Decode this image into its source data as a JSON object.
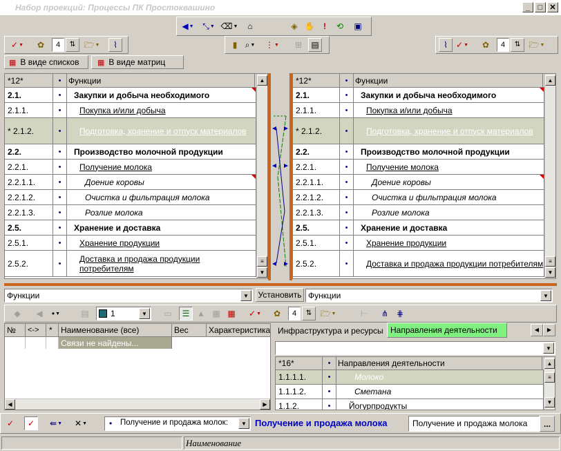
{
  "window": {
    "title": "Набор проекций: Процессы ПК Простоквашино",
    "min": "_",
    "max": "□",
    "close": "✕"
  },
  "toolbar_left": {
    "counter": "4"
  },
  "toolbar_right": {
    "counter": "4"
  },
  "view_tabs": {
    "list": "В виде списков",
    "matrix": "В виде матриц"
  },
  "left_table": {
    "header": {
      "col1": "*12*",
      "col2": "•",
      "col3": "Функции"
    },
    "rows": [
      {
        "num": "2.1.",
        "dot": "•",
        "name": "Закупки и добыча необходимого"
      },
      {
        "num": "2.1.1.",
        "dot": "•",
        "name": "Покупка и/или добыча"
      },
      {
        "num": "* 2.1.2.",
        "dot": "•",
        "name": "Подготовка, хранение и отпуск материалов"
      },
      {
        "num": "2.2.",
        "dot": "•",
        "name": "Производство молочной продукции"
      },
      {
        "num": "2.2.1.",
        "dot": "•",
        "name": "Получение молока"
      },
      {
        "num": "2.2.1.1.",
        "dot": "•",
        "name": "Доение коровы"
      },
      {
        "num": "2.2.1.2.",
        "dot": "•",
        "name": "Очистка и фильтрация молока"
      },
      {
        "num": "2.2.1.3.",
        "dot": "•",
        "name": "Розлие молока"
      },
      {
        "num": "2.5.",
        "dot": "•",
        "name": "Хранение и доставка"
      },
      {
        "num": "2.5.1.",
        "dot": "•",
        "name": "Хранение продукции"
      },
      {
        "num": "2.5.2.",
        "dot": "•",
        "name": "Доставка и продажа продукции потребителям"
      }
    ]
  },
  "right_table": {
    "header": {
      "col1": "*12*",
      "col2": "•",
      "col3": "Функции"
    },
    "rows": [
      {
        "num": "2.1.",
        "dot": "•",
        "name": "Закупки и добыча необходимого"
      },
      {
        "num": "2.1.1.",
        "dot": "•",
        "name": "Покупка и/или добыча"
      },
      {
        "num": "* 2.1.2.",
        "dot": "•",
        "name": "Подготовка, хранение и отпуск материалов"
      },
      {
        "num": "2.2.",
        "dot": "•",
        "name": "Производство молочной продукции"
      },
      {
        "num": "2.2.1.",
        "dot": "•",
        "name": "Получение молока"
      },
      {
        "num": "2.2.1.1.",
        "dot": "•",
        "name": "Доение коровы"
      },
      {
        "num": "2.2.1.2.",
        "dot": "•",
        "name": "Очистка и фильтрация молока"
      },
      {
        "num": "2.2.1.3.",
        "dot": "•",
        "name": "Розлие молока"
      },
      {
        "num": "2.5.",
        "dot": "•",
        "name": "Хранение и доставка"
      },
      {
        "num": "2.5.1.",
        "dot": "•",
        "name": "Хранение продукции"
      },
      {
        "num": "2.5.2.",
        "dot": "•",
        "name": "Доставка и продажа продукции потребителям"
      }
    ]
  },
  "filter": {
    "left_value": "Функции",
    "apply_button": "Установить",
    "right_value": "Функции"
  },
  "lower_toolbar": {
    "dot_value": "•",
    "level_value": "1",
    "counter": "4"
  },
  "links_table": {
    "headers": {
      "num": "№",
      "dir": "<->",
      "star": "*",
      "name": "Наименование (все)",
      "weight": "Вес",
      "char": "Характеристика"
    },
    "empty_message": "Связи не найдены..."
  },
  "right_tabs": {
    "infra": "Инфраструктура и ресурсы",
    "directions": "Направления деятельности"
  },
  "directions_table": {
    "header": {
      "col1": "*16*",
      "col2": "•",
      "col3": "Направления деятельности"
    },
    "rows": [
      {
        "num": "1.1.1.1.",
        "dot": "•",
        "name": "Молоко"
      },
      {
        "num": "1.1.1.2.",
        "dot": "•",
        "name": "Сметана"
      },
      {
        "num": "1.1.2.",
        "dot": "•",
        "name": "Йогурпродукты"
      }
    ]
  },
  "bottom_bar": {
    "current_value": "Получение и продажа молок:",
    "blue_label": "Получение и продажа молока",
    "field_value": "Получение и продажа молока",
    "more": "..."
  },
  "status": {
    "label": "Наименование"
  }
}
